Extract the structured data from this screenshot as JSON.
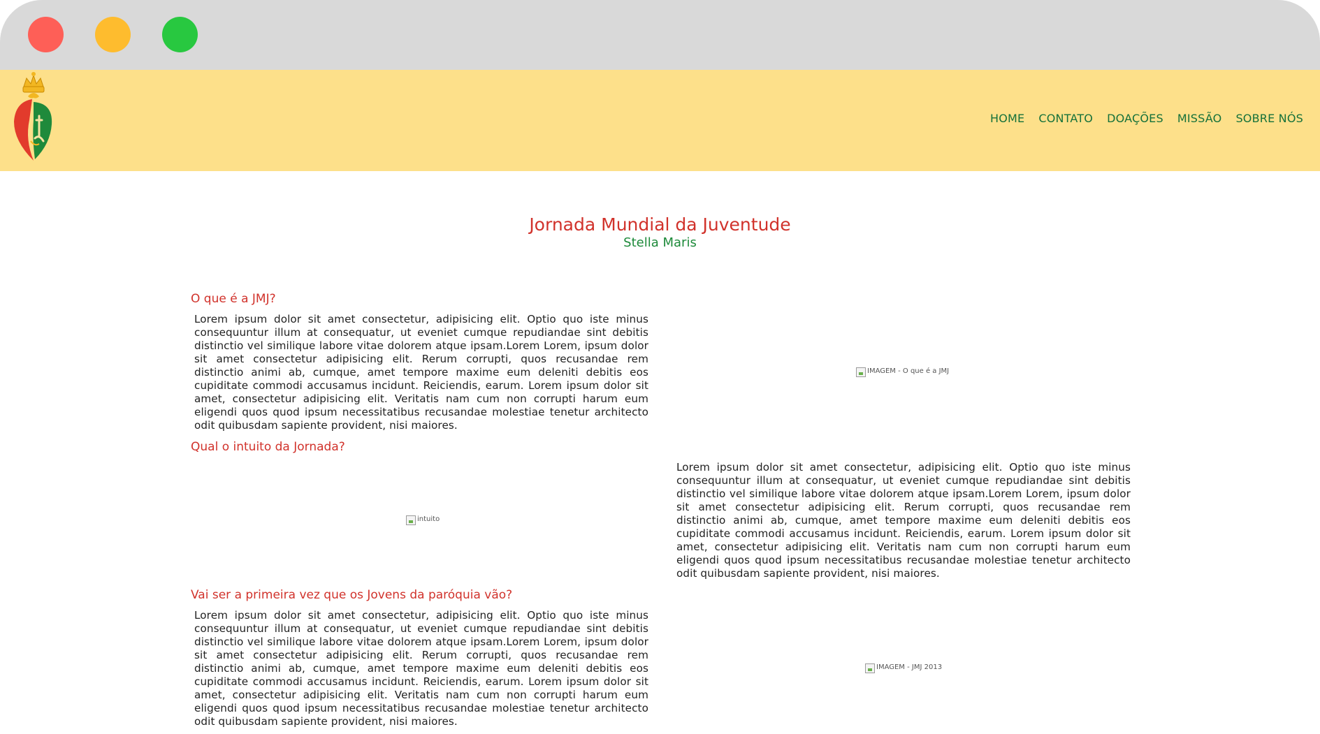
{
  "nav": {
    "items": [
      "HOME",
      "CONTATO",
      "DOAÇÕES",
      "MISSÃO",
      "SOBRE NÓS"
    ]
  },
  "hero": {
    "title": "Jornada Mundial da Juventude",
    "subtitle": "Stella Maris"
  },
  "sections": {
    "s1": {
      "heading": "O que é a JMJ?",
      "text": "Lorem ipsum dolor sit amet consectetur, adipisicing elit. Optio quo iste minus consequuntur illum at consequatur, ut eveniet cumque repudiandae sint debitis distinctio vel similique labore vitae dolorem atque ipsam.Lorem Lorem, ipsum dolor sit amet consectetur adipisicing elit. Rerum corrupti, quos recusandae rem distinctio animi ab, cumque, amet tempore maxime eum deleniti debitis eos cupiditate commodi accusamus incidunt. Reiciendis, earum. Lorem ipsum dolor sit amet, consectetur adipisicing elit. Veritatis nam cum non corrupti harum eum eligendi quos quod ipsum necessitatibus recusandae molestiae tenetur architecto odit quibusdam sapiente provident, nisi maiores.",
      "image_alt": "IMAGEM - O que é a JMJ"
    },
    "s2": {
      "heading": "Qual o intuito da Jornada?",
      "text": "Lorem ipsum dolor sit amet consectetur, adipisicing elit. Optio quo iste minus consequuntur illum at consequatur, ut eveniet cumque repudiandae sint debitis distinctio vel similique labore vitae dolorem atque ipsam.Lorem Lorem, ipsum dolor sit amet consectetur adipisicing elit. Rerum corrupti, quos recusandae rem distinctio animi ab, cumque, amet tempore maxime eum deleniti debitis eos cupiditate commodi accusamus incidunt. Reiciendis, earum. Lorem ipsum dolor sit amet, consectetur adipisicing elit. Veritatis nam cum non corrupti harum eum eligendi quos quod ipsum necessitatibus recusandae molestiae tenetur architecto odit quibusdam sapiente provident, nisi maiores.",
      "image_alt": "intuito"
    },
    "s3": {
      "heading": "Vai ser a primeira vez que os Jovens da paróquia vão?",
      "text": "Lorem ipsum dolor sit amet consectetur, adipisicing elit. Optio quo iste minus consequuntur illum at consequatur, ut eveniet cumque repudiandae sint debitis distinctio vel similique labore vitae dolorem atque ipsam.Lorem Lorem, ipsum dolor sit amet consectetur adipisicing elit. Rerum corrupti, quos recusandae rem distinctio animi ab, cumque, amet tempore maxime eum deleniti debitis eos cupiditate commodi accusamus incidunt. Reiciendis, earum. Lorem ipsum dolor sit amet, consectetur adipisicing elit. Veritatis nam cum non corrupti harum eum eligendi quos quod ipsum necessitatibus recusandae molestiae tenetur architecto odit quibusdam sapiente provident, nisi maiores.",
      "image_alt": "IMAGEM - JMJ 2013"
    }
  },
  "colors": {
    "header_bg": "#fde08a",
    "nav_text": "#15713a",
    "title_red": "#d1322b",
    "subtitle_green": "#1d8a3a"
  }
}
